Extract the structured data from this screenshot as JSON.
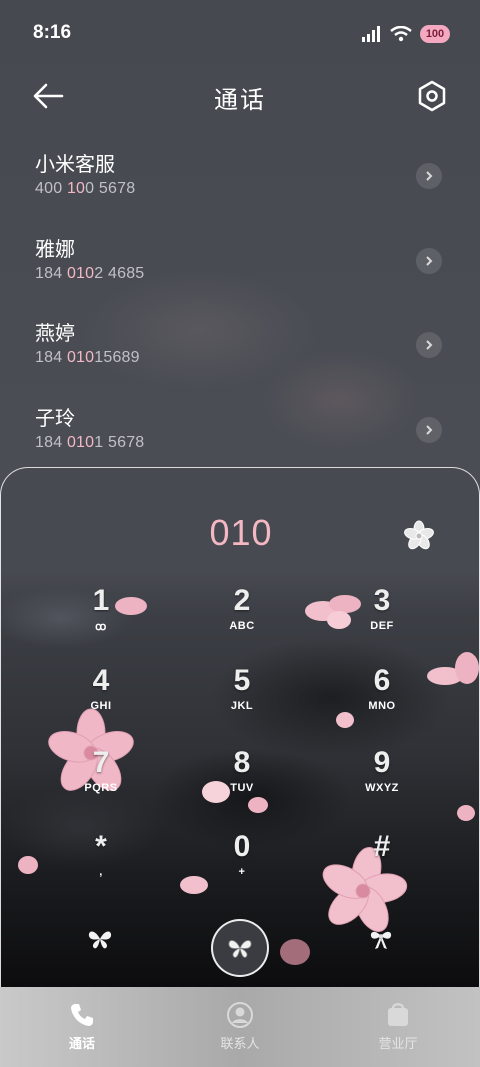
{
  "status_bar": {
    "time": "8:16",
    "battery": "100",
    "icons": [
      "signal-icon",
      "wifi-icon",
      "battery-icon"
    ]
  },
  "header": {
    "title": "通话",
    "back_icon": "back-arrow-icon",
    "settings_icon": "settings-hexagon-icon"
  },
  "contacts": [
    {
      "name": "小米客服",
      "number_parts": [
        "400 ",
        "10",
        "0 5678"
      ]
    },
    {
      "name": "雅娜",
      "number_parts": [
        "184 ",
        "010",
        "2 4685"
      ]
    },
    {
      "name": "燕婷",
      "number_parts": [
        "184 ",
        "010",
        "15689"
      ]
    },
    {
      "name": "子玲",
      "number_parts": [
        "184 ",
        "010",
        "1 5678"
      ]
    }
  ],
  "dialpad": {
    "input": "010",
    "keys": [
      {
        "digit": "1",
        "letters": "ꝏ"
      },
      {
        "digit": "2",
        "letters": "ABC"
      },
      {
        "digit": "3",
        "letters": "DEF"
      },
      {
        "digit": "4",
        "letters": "GHI"
      },
      {
        "digit": "5",
        "letters": "JKL"
      },
      {
        "digit": "6",
        "letters": "MNO"
      },
      {
        "digit": "7",
        "letters": "PQRS"
      },
      {
        "digit": "8",
        "letters": "TUV"
      },
      {
        "digit": "9",
        "letters": "WXYZ"
      },
      {
        "digit": "*",
        "letters": ","
      },
      {
        "digit": "0",
        "letters": "+"
      },
      {
        "digit": "#",
        "letters": ""
      }
    ],
    "left_icon": "butterfly-icon",
    "call_icon": "butterfly-call-icon",
    "right_icon": "bow-icon",
    "flower_icon": "flower-icon"
  },
  "bottom_nav": [
    {
      "label": "通话",
      "icon": "phone-icon",
      "active": true
    },
    {
      "label": "联系人",
      "icon": "contact-person-icon",
      "active": false
    },
    {
      "label": "营业厅",
      "icon": "shopping-bag-icon",
      "active": false
    }
  ],
  "colors": {
    "accent_pink": "#f3b8c4",
    "background": "#4a4d54",
    "nav_bg": "#b8b8b8"
  }
}
